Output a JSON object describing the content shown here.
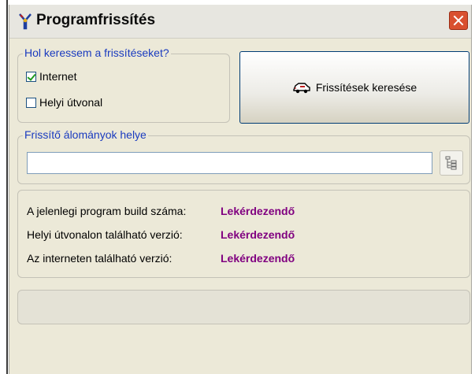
{
  "window": {
    "title": "Programfrissítés"
  },
  "search_group": {
    "legend": "Hol keressem a frissítéseket?",
    "options": [
      {
        "label": "Internet",
        "checked": true
      },
      {
        "label": "Helyi útvonal",
        "checked": false
      }
    ]
  },
  "search_button": {
    "label": "Frissítések keresése"
  },
  "files_group": {
    "legend": "Frissítő álományok helye",
    "path_value": ""
  },
  "info": {
    "rows": [
      {
        "label": "A jelenlegi program build száma:",
        "value": "Lekérdezendő"
      },
      {
        "label": "Helyi útvonalon található verzió:",
        "value": "Lekérdezendő"
      },
      {
        "label": "Az interneten található verzió:",
        "value": "Lekérdezendő"
      }
    ]
  },
  "status": {
    "text": ""
  },
  "colors": {
    "legend": "#1a3bbf",
    "value": "#800080",
    "close": "#d9502f"
  },
  "icons": {
    "title": "program-update-icon",
    "close": "close-icon",
    "search": "car-icon",
    "browse": "folder-tree-icon"
  }
}
